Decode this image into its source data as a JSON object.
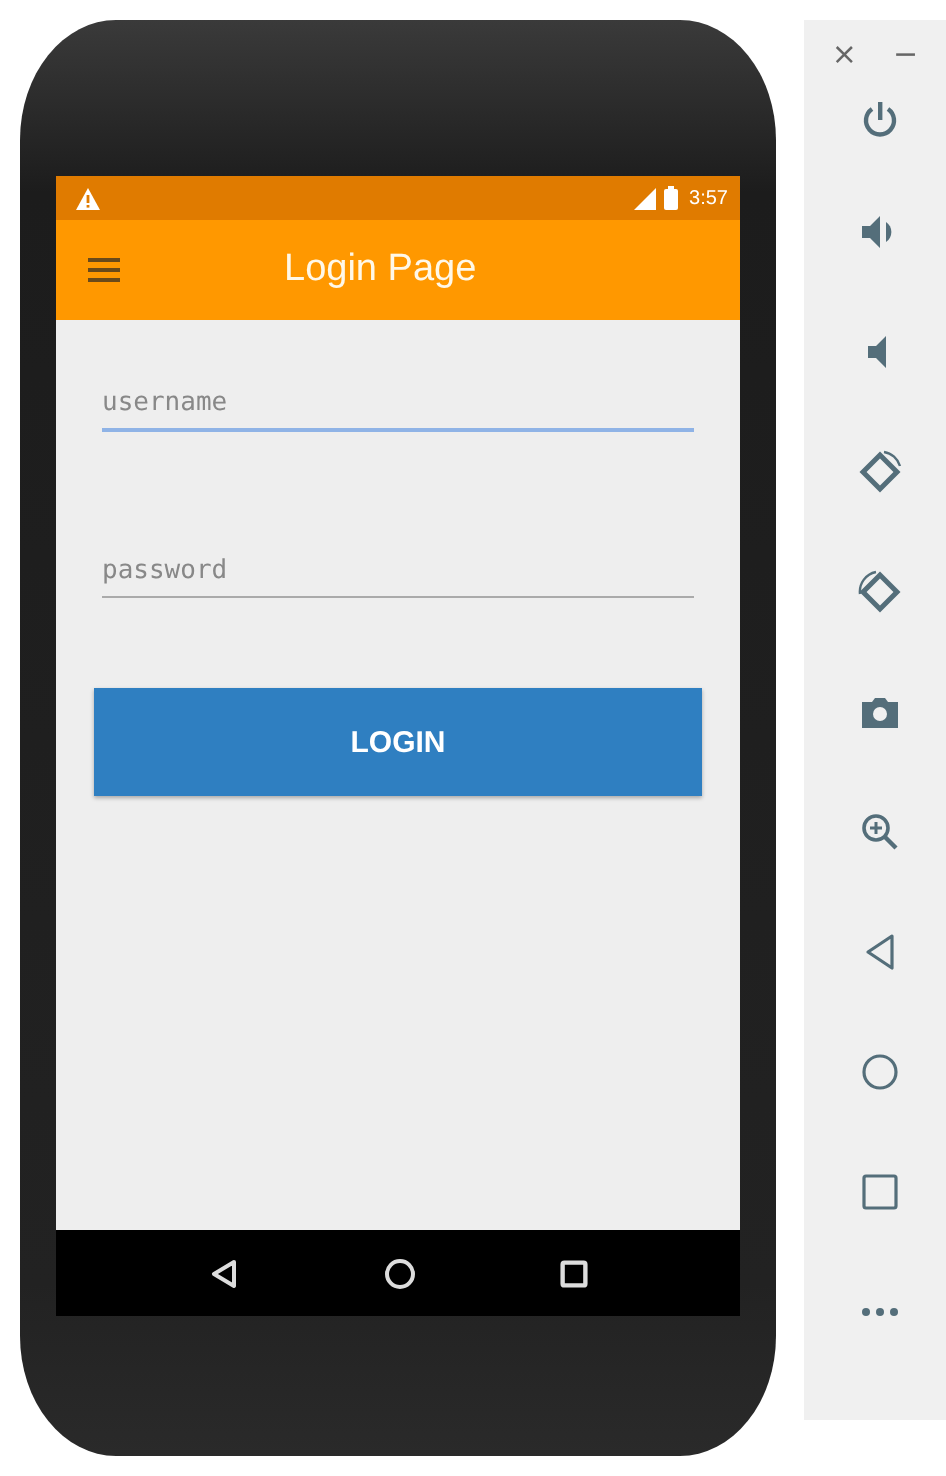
{
  "status_bar": {
    "time": "3:57"
  },
  "app_bar": {
    "title": "Login Page"
  },
  "form": {
    "fields": [
      {
        "placeholder": "username",
        "focused": true
      },
      {
        "placeholder": "password",
        "focused": false
      }
    ],
    "button": "LOGIN"
  },
  "emulator_panel": {
    "window_controls": [
      "×",
      "−"
    ],
    "tools": [
      {
        "kind": "power"
      },
      {
        "kind": "volume_up"
      },
      {
        "kind": "volume_down"
      },
      {
        "kind": "rotate_left"
      },
      {
        "kind": "rotate_right"
      },
      {
        "kind": "camera"
      },
      {
        "kind": "zoom"
      },
      {
        "kind": "back"
      },
      {
        "kind": "home"
      },
      {
        "kind": "overview"
      },
      {
        "kind": "more"
      }
    ]
  }
}
